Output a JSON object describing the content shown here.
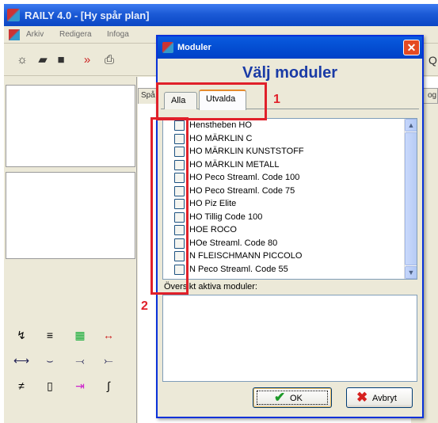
{
  "main_window": {
    "title": "RAILY 4.0 - [Hy spår plan]",
    "menu": [
      "Arkiv",
      "Redigera",
      "Infoga"
    ],
    "side_tab_left": "Spå",
    "side_tab_right": "og"
  },
  "dialog": {
    "title": "Moduler",
    "close_glyph": "✕",
    "heading": "Välj moduler",
    "tabs": [
      "Alla",
      "Utvalda"
    ],
    "modules": [
      "Henstheben HO",
      "HO MÄRKLIN C",
      "HO MÄRKLIN KUNSTSTOFF",
      "HO MÄRKLIN METALL",
      "HO Peco Streaml. Code 100",
      "HO Peco Streaml. Code 75",
      "HO Piz Elite",
      "HO Tillig Code 100",
      "HOE ROCO",
      "HOe Streaml. Code 80",
      "N FLEISCHMANN PICCOLO",
      "N Peco Streaml. Code 55"
    ],
    "overview_label": "Översikt aktiva moduler:",
    "ok_label": "OK",
    "cancel_label": "Avbryt"
  },
  "annotations": {
    "one": "1",
    "two": "2",
    "color": "#e0202a"
  },
  "icons": {
    "ok": "check-icon",
    "cancel": "x-icon",
    "scroll_up": "chevron-up-icon",
    "scroll_down": "chevron-down-icon"
  }
}
